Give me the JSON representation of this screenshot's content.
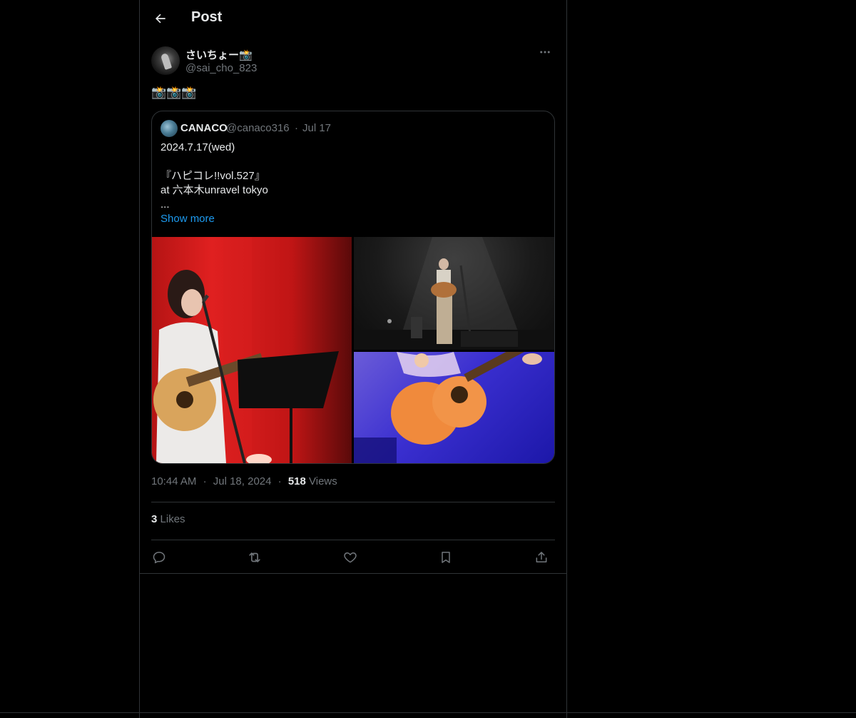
{
  "header": {
    "title": "Post"
  },
  "author": {
    "display_name": "さいちょー📸",
    "handle": "@sai_cho_823"
  },
  "post": {
    "text": "📸📸📸"
  },
  "quoted_post": {
    "display_name": "CANACO",
    "handle": "@canaco316",
    "separator": "·",
    "date": "Jul 17",
    "lines": [
      "2024.7.17(wed)",
      "",
      "『ハピコレ!!vol.527』",
      "at 六本木unravel tokyo",
      "..."
    ],
    "show_more": "Show more"
  },
  "meta": {
    "time": "10:44 AM",
    "separator": "·",
    "date": "Jul 18, 2024",
    "views_count": "518",
    "views_label": "Views"
  },
  "engagement": {
    "likes_count": "3",
    "likes_label": "Likes"
  },
  "icons": {
    "back": "arrow-left-icon",
    "more": "more-horizontal-icon",
    "reply": "reply-icon",
    "repost": "repost-icon",
    "like": "heart-icon",
    "bookmark": "bookmark-icon",
    "share": "share-icon"
  },
  "colors": {
    "background": "#000000",
    "text": "#e7e9ea",
    "secondary": "#71767b",
    "border": "#2f3336",
    "accent": "#1d9bf0"
  }
}
